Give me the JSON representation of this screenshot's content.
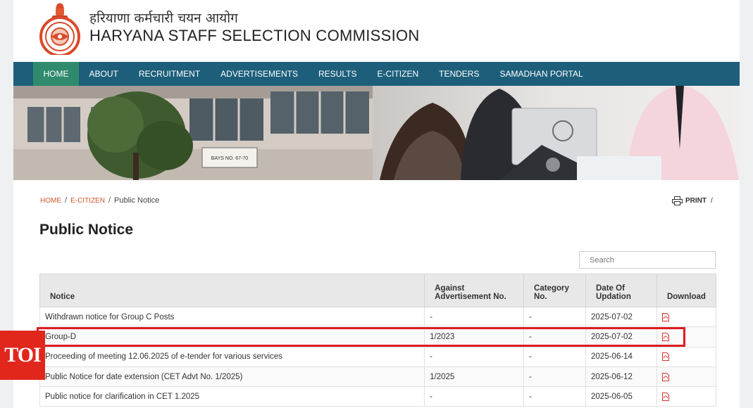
{
  "header": {
    "title_hindi": "हरियाणा कर्मचारी चयन आयोग",
    "title_english": "HARYANA STAFF SELECTION COMMISSION",
    "emblem_icon": "haryana-emblem-icon"
  },
  "nav": {
    "items": [
      {
        "label": "HOME",
        "active": true
      },
      {
        "label": "ABOUT"
      },
      {
        "label": "RECRUITMENT"
      },
      {
        "label": "ADVERTISEMENTS"
      },
      {
        "label": "RESULTS"
      },
      {
        "label": "E-CITIZEN"
      },
      {
        "label": "TENDERS"
      },
      {
        "label": "SAMADHAN PORTAL"
      }
    ]
  },
  "banner": {
    "sign_text": "BAYS NO. 67-70"
  },
  "breadcrumb": {
    "home": "HOME",
    "ecitizen": "E-CITIZEN",
    "separator": "/",
    "current": "Public Notice"
  },
  "print": {
    "label": "PRINT",
    "suffix": "/"
  },
  "page_title": "Public Notice",
  "search": {
    "placeholder": "Search"
  },
  "table": {
    "headers": {
      "notice": "Notice",
      "advertisement_no": "Against Advertisement No.",
      "category_no": "Category No.",
      "date": "Date Of Updation",
      "download": "Download"
    },
    "rows": [
      {
        "notice": "Withdrawn notice for Group C Posts",
        "advertisement_no": "-",
        "category_no": "-",
        "date": "2025-07-02"
      },
      {
        "notice": "Group-D",
        "advertisement_no": "1/2023",
        "category_no": "-",
        "date": "2025-07-02"
      },
      {
        "notice": "Proceeding of meeting 12.06.2025 of e-tender for various services",
        "advertisement_no": "-",
        "category_no": "-",
        "date": "2025-06-14"
      },
      {
        "notice": "Public Notice for date extension (CET Advt No. 1/2025)",
        "advertisement_no": "1/2025",
        "category_no": "-",
        "date": "2025-06-12"
      },
      {
        "notice": "Public notice for clarification in CET 1.2025",
        "advertisement_no": "-",
        "category_no": "-",
        "date": "2025-06-05"
      }
    ]
  },
  "watermark": {
    "label": "TOI"
  },
  "colors": {
    "nav_bg": "#1d5f7b",
    "nav_active": "#2f8a6e",
    "breadcrumb_link": "#d0572b",
    "highlight": "#e01b22",
    "toi_red": "#e1261c"
  }
}
